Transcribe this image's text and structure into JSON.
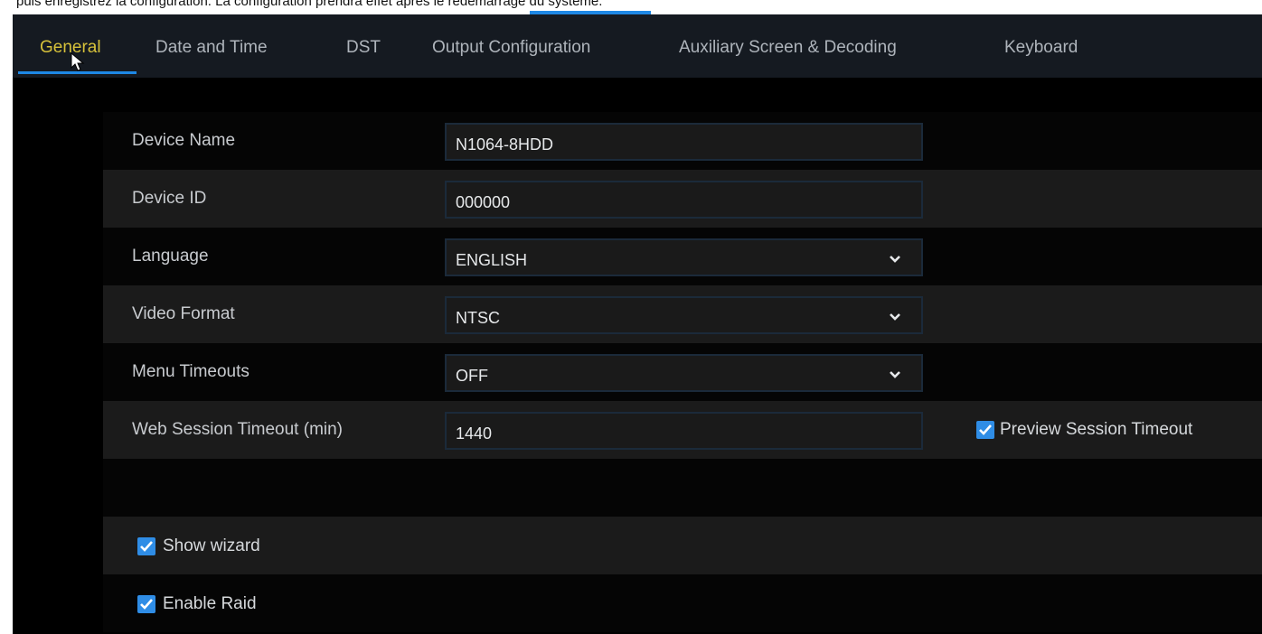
{
  "doc_text": "puis enregistrez la configuration. La configuration prendra effet après le redémarrage du système.",
  "tabs": [
    {
      "label": "General"
    },
    {
      "label": "Date and Time"
    },
    {
      "label": "DST"
    },
    {
      "label": "Output Configuration"
    },
    {
      "label": "Auxiliary Screen & Decoding"
    },
    {
      "label": "Keyboard"
    }
  ],
  "fields": {
    "device_name": {
      "label": "Device Name",
      "value": "N1064-8HDD"
    },
    "device_id": {
      "label": "Device ID",
      "value": "000000"
    },
    "language": {
      "label": "Language",
      "value": "ENGLISH"
    },
    "video_format": {
      "label": "Video Format",
      "value": "NTSC"
    },
    "menu_timeouts": {
      "label": "Menu Timeouts",
      "value": "OFF"
    },
    "web_session_timeout": {
      "label": "Web Session Timeout (min)",
      "value": "1440"
    }
  },
  "checkboxes": {
    "preview_session_timeout": {
      "label": "Preview Session Timeout",
      "checked": true
    },
    "show_wizard": {
      "label": "Show wizard",
      "checked": true
    },
    "enable_raid": {
      "label": "Enable Raid",
      "checked": true
    }
  },
  "colors": {
    "accent": "#1e88e5",
    "active_tab": "#d6c13a",
    "checkbox": "#2f8de6"
  }
}
